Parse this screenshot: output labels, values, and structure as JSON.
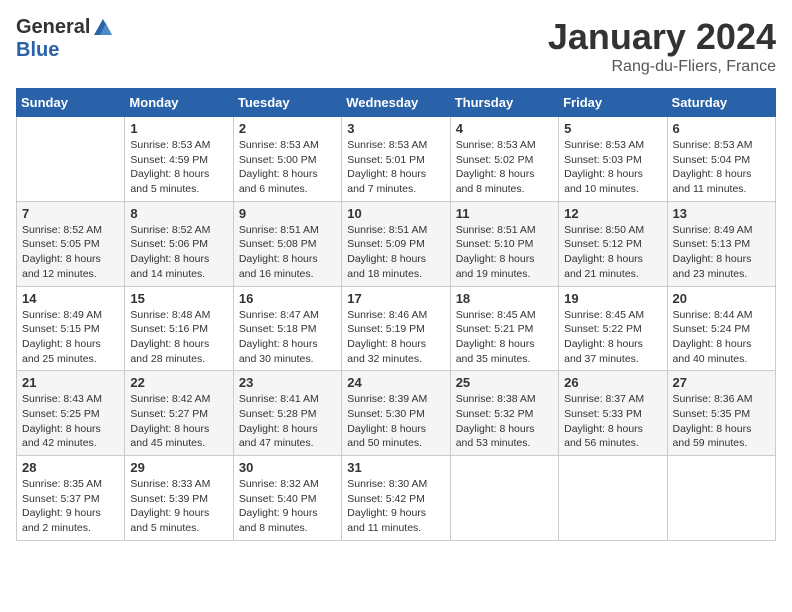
{
  "header": {
    "logo_general": "General",
    "logo_blue": "Blue",
    "month_title": "January 2024",
    "location": "Rang-du-Fliers, France"
  },
  "days_of_week": [
    "Sunday",
    "Monday",
    "Tuesday",
    "Wednesday",
    "Thursday",
    "Friday",
    "Saturday"
  ],
  "weeks": [
    [
      {
        "day": "",
        "info": ""
      },
      {
        "day": "1",
        "info": "Sunrise: 8:53 AM\nSunset: 4:59 PM\nDaylight: 8 hours\nand 5 minutes."
      },
      {
        "day": "2",
        "info": "Sunrise: 8:53 AM\nSunset: 5:00 PM\nDaylight: 8 hours\nand 6 minutes."
      },
      {
        "day": "3",
        "info": "Sunrise: 8:53 AM\nSunset: 5:01 PM\nDaylight: 8 hours\nand 7 minutes."
      },
      {
        "day": "4",
        "info": "Sunrise: 8:53 AM\nSunset: 5:02 PM\nDaylight: 8 hours\nand 8 minutes."
      },
      {
        "day": "5",
        "info": "Sunrise: 8:53 AM\nSunset: 5:03 PM\nDaylight: 8 hours\nand 10 minutes."
      },
      {
        "day": "6",
        "info": "Sunrise: 8:53 AM\nSunset: 5:04 PM\nDaylight: 8 hours\nand 11 minutes."
      }
    ],
    [
      {
        "day": "7",
        "info": "Sunrise: 8:52 AM\nSunset: 5:05 PM\nDaylight: 8 hours\nand 12 minutes."
      },
      {
        "day": "8",
        "info": "Sunrise: 8:52 AM\nSunset: 5:06 PM\nDaylight: 8 hours\nand 14 minutes."
      },
      {
        "day": "9",
        "info": "Sunrise: 8:51 AM\nSunset: 5:08 PM\nDaylight: 8 hours\nand 16 minutes."
      },
      {
        "day": "10",
        "info": "Sunrise: 8:51 AM\nSunset: 5:09 PM\nDaylight: 8 hours\nand 18 minutes."
      },
      {
        "day": "11",
        "info": "Sunrise: 8:51 AM\nSunset: 5:10 PM\nDaylight: 8 hours\nand 19 minutes."
      },
      {
        "day": "12",
        "info": "Sunrise: 8:50 AM\nSunset: 5:12 PM\nDaylight: 8 hours\nand 21 minutes."
      },
      {
        "day": "13",
        "info": "Sunrise: 8:49 AM\nSunset: 5:13 PM\nDaylight: 8 hours\nand 23 minutes."
      }
    ],
    [
      {
        "day": "14",
        "info": "Sunrise: 8:49 AM\nSunset: 5:15 PM\nDaylight: 8 hours\nand 25 minutes."
      },
      {
        "day": "15",
        "info": "Sunrise: 8:48 AM\nSunset: 5:16 PM\nDaylight: 8 hours\nand 28 minutes."
      },
      {
        "day": "16",
        "info": "Sunrise: 8:47 AM\nSunset: 5:18 PM\nDaylight: 8 hours\nand 30 minutes."
      },
      {
        "day": "17",
        "info": "Sunrise: 8:46 AM\nSunset: 5:19 PM\nDaylight: 8 hours\nand 32 minutes."
      },
      {
        "day": "18",
        "info": "Sunrise: 8:45 AM\nSunset: 5:21 PM\nDaylight: 8 hours\nand 35 minutes."
      },
      {
        "day": "19",
        "info": "Sunrise: 8:45 AM\nSunset: 5:22 PM\nDaylight: 8 hours\nand 37 minutes."
      },
      {
        "day": "20",
        "info": "Sunrise: 8:44 AM\nSunset: 5:24 PM\nDaylight: 8 hours\nand 40 minutes."
      }
    ],
    [
      {
        "day": "21",
        "info": "Sunrise: 8:43 AM\nSunset: 5:25 PM\nDaylight: 8 hours\nand 42 minutes."
      },
      {
        "day": "22",
        "info": "Sunrise: 8:42 AM\nSunset: 5:27 PM\nDaylight: 8 hours\nand 45 minutes."
      },
      {
        "day": "23",
        "info": "Sunrise: 8:41 AM\nSunset: 5:28 PM\nDaylight: 8 hours\nand 47 minutes."
      },
      {
        "day": "24",
        "info": "Sunrise: 8:39 AM\nSunset: 5:30 PM\nDaylight: 8 hours\nand 50 minutes."
      },
      {
        "day": "25",
        "info": "Sunrise: 8:38 AM\nSunset: 5:32 PM\nDaylight: 8 hours\nand 53 minutes."
      },
      {
        "day": "26",
        "info": "Sunrise: 8:37 AM\nSunset: 5:33 PM\nDaylight: 8 hours\nand 56 minutes."
      },
      {
        "day": "27",
        "info": "Sunrise: 8:36 AM\nSunset: 5:35 PM\nDaylight: 8 hours\nand 59 minutes."
      }
    ],
    [
      {
        "day": "28",
        "info": "Sunrise: 8:35 AM\nSunset: 5:37 PM\nDaylight: 9 hours\nand 2 minutes."
      },
      {
        "day": "29",
        "info": "Sunrise: 8:33 AM\nSunset: 5:39 PM\nDaylight: 9 hours\nand 5 minutes."
      },
      {
        "day": "30",
        "info": "Sunrise: 8:32 AM\nSunset: 5:40 PM\nDaylight: 9 hours\nand 8 minutes."
      },
      {
        "day": "31",
        "info": "Sunrise: 8:30 AM\nSunset: 5:42 PM\nDaylight: 9 hours\nand 11 minutes."
      },
      {
        "day": "",
        "info": ""
      },
      {
        "day": "",
        "info": ""
      },
      {
        "day": "",
        "info": ""
      }
    ]
  ]
}
